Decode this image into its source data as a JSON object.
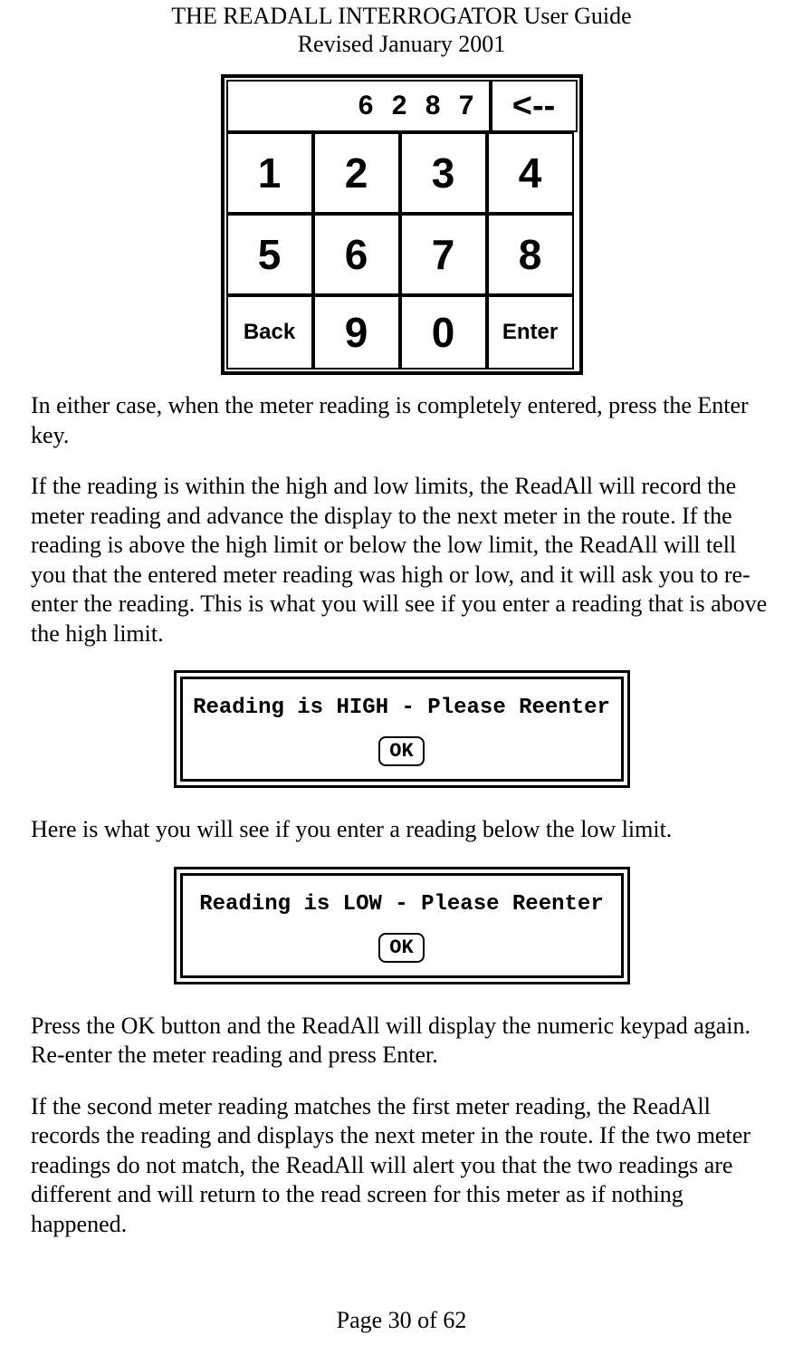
{
  "header": {
    "title": "THE READALL INTERROGATOR User Guide",
    "subtitle": "Revised January 2001"
  },
  "keypad": {
    "display_value": "6 2 8 7",
    "back_arrow": "<--",
    "keys": {
      "k1": "1",
      "k2": "2",
      "k3": "3",
      "k4": "4",
      "k5": "5",
      "k6": "6",
      "k7": "7",
      "k8": "8",
      "k9": "9",
      "k0": "0",
      "back": "Back",
      "enter": "Enter"
    }
  },
  "paragraphs": {
    "p1": "In either case, when the meter reading is completely entered, press the Enter key.",
    "p2": "If the reading is within the high and low limits, the ReadAll will record the meter reading and advance the display to the next meter in the route.  If the reading is above the high limit or below the low limit, the ReadAll will tell you that the entered meter reading was high or low, and it will ask you to re-enter the reading.  This is what you will see if you enter a reading that is above the high limit.",
    "p3": "Here is what you will see if you enter a reading below the low limit.",
    "p4": "Press the OK button and the ReadAll will display the numeric keypad again.  Re-enter the meter reading and press Enter.",
    "p5": "If the second meter reading matches the first meter reading, the ReadAll records the reading and displays the next meter in the route.  If the two meter readings do not match, the ReadAll will alert you that the two readings are different and will return to the read screen for this meter as if nothing happened."
  },
  "dialogs": {
    "high": {
      "message": "Reading is HIGH - Please Reenter",
      "ok": "OK"
    },
    "low": {
      "message": "Reading is LOW - Please Reenter",
      "ok": "OK"
    }
  },
  "footer": {
    "page": "Page 30 of 62"
  }
}
